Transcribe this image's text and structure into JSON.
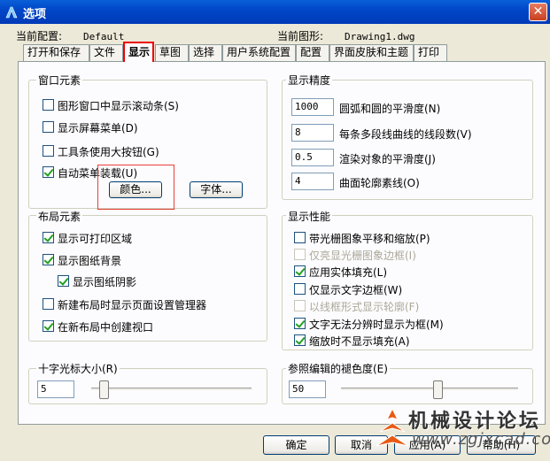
{
  "window": {
    "title": "选项",
    "close_glyph": "✕"
  },
  "info": {
    "current_profile_label": "当前配置:",
    "current_profile_value": "Default",
    "current_drawing_label": "当前图形:",
    "current_drawing_value": "Drawing1.dwg"
  },
  "tabs": [
    "打开和保存",
    "文件",
    "显示",
    "草图",
    "选择",
    "用户系统配置",
    "配置",
    "界面皮肤和主题",
    "打印"
  ],
  "active_tab": "显示",
  "window_elements": {
    "title": "窗口元素",
    "items": [
      {
        "label": "图形窗口中显示滚动条(S)",
        "checked": false
      },
      {
        "label": "显示屏幕菜单(D)",
        "checked": false
      },
      {
        "label": "工具条使用大按钮(G)",
        "checked": false
      },
      {
        "label": "自动菜单装载(U)",
        "checked": true
      }
    ],
    "colors_button": "颜色...",
    "fonts_button": "字体..."
  },
  "layout_elements": {
    "title": "布局元素",
    "items": [
      {
        "label": "显示可打印区域",
        "checked": true
      },
      {
        "label": "显示图纸背景",
        "checked": true
      },
      {
        "label": "显示图纸阴影",
        "checked": true
      },
      {
        "label": "新建布局时显示页面设置管理器",
        "checked": false
      },
      {
        "label": "在新布局中创建视口",
        "checked": true
      }
    ]
  },
  "crosshair": {
    "title": "十字光标大小(R)",
    "value": "5",
    "slider_fraction": 0.05
  },
  "display_resolution": {
    "title": "显示精度",
    "items": [
      {
        "value": "1000",
        "label": "圆弧和圆的平滑度(N)"
      },
      {
        "value": "8",
        "label": "每条多段线曲线的线段数(V)"
      },
      {
        "value": "0.5",
        "label": "渲染对象的平滑度(J)"
      },
      {
        "value": "4",
        "label": "曲面轮廓素线(O)"
      }
    ]
  },
  "display_performance": {
    "title": "显示性能",
    "items": [
      {
        "label": "带光栅图象平移和缩放(P)",
        "checked": false,
        "disabled": false
      },
      {
        "label": "仅亮显光栅图象边框(I)",
        "checked": false,
        "disabled": true
      },
      {
        "label": "应用实体填充(L)",
        "checked": true,
        "disabled": false
      },
      {
        "label": "仅显示文字边框(W)",
        "checked": false,
        "disabled": false
      },
      {
        "label": "以线框形式显示轮廓(F)",
        "checked": false,
        "disabled": true
      },
      {
        "label": "文字无法分辨时显示为框(M)",
        "checked": true,
        "disabled": false
      },
      {
        "label": "缩放时不显示填充(A)",
        "checked": true,
        "disabled": false
      }
    ]
  },
  "xref_fade": {
    "title": "参照编辑的褪色度(E)",
    "value": "50",
    "slider_fraction": 0.55
  },
  "buttons": {
    "ok": "确定",
    "cancel": "取消",
    "apply": "应用(A)",
    "help": "帮助(H)"
  },
  "watermark": {
    "text": "机械设计论坛",
    "url": "www.zgjxcad.com"
  },
  "colors": {
    "title_bar": "#0047c8",
    "highlight": "#e00000",
    "check": "#21a121"
  }
}
